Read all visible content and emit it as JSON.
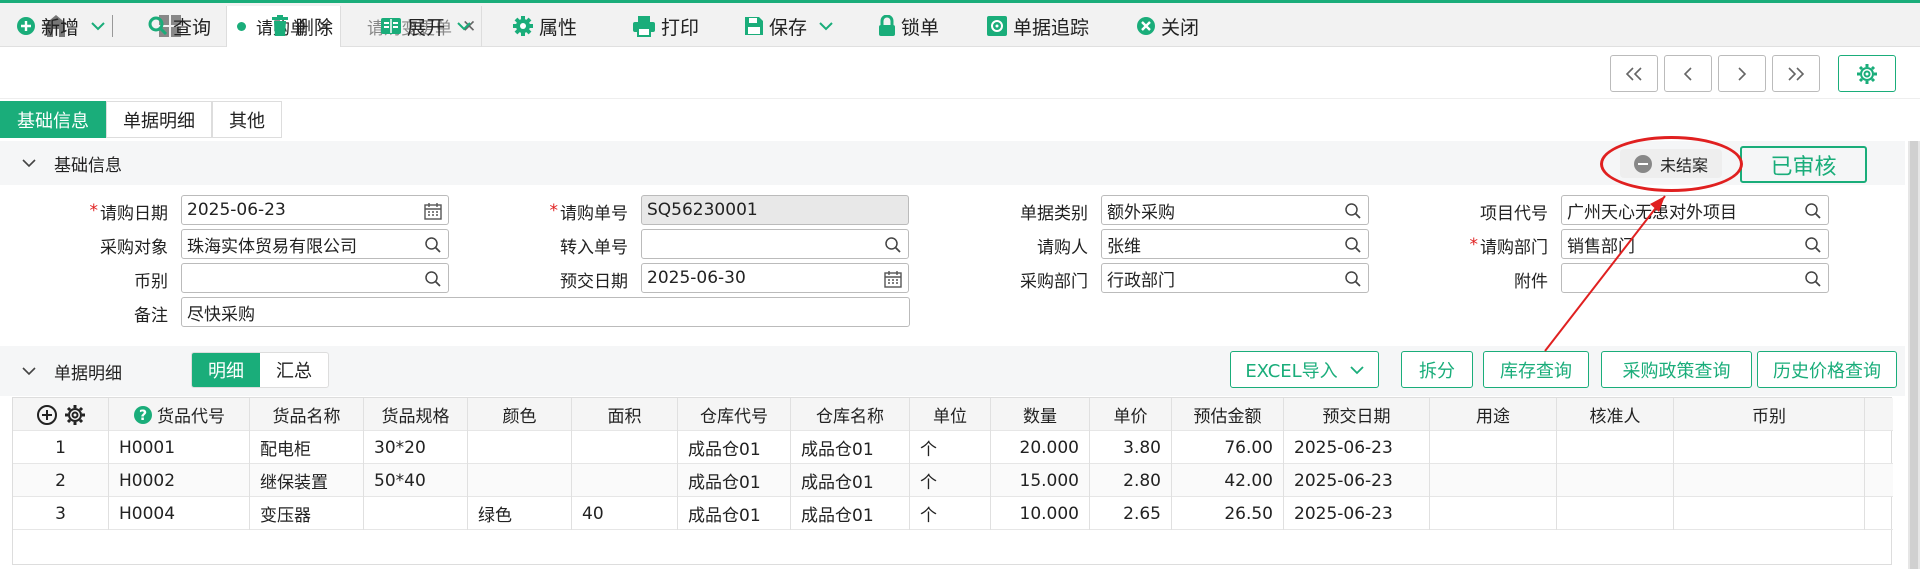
{
  "tabs": [
    {
      "label": "请购单",
      "active": true
    },
    {
      "label": "请购变更单",
      "active": false
    }
  ],
  "toolbar": {
    "new": "新增",
    "query": "查询",
    "delete": "删除",
    "expand": "展开",
    "properties": "属性",
    "print": "打印",
    "save": "保存",
    "lock": "锁单",
    "trace": "单据追踪",
    "close": "关闭"
  },
  "section_tabs": [
    "基础信息",
    "单据明细",
    "其他"
  ],
  "basic_section_title": "基础信息",
  "status_pill": "未结案",
  "audit_label": "已审核",
  "form": {
    "req_date_label": "请购日期",
    "req_date": "2025-06-23",
    "req_no_label": "请购单号",
    "req_no": "SQ56230001",
    "doc_type_label": "单据类别",
    "doc_type": "额外采购",
    "project_code_label": "项目代号",
    "project_code": "广州天心无患对外项目",
    "purchase_target_label": "采购对象",
    "purchase_target": "珠海实体贸易有限公司",
    "transfer_no_label": "转入单号",
    "transfer_no": "",
    "requester_label": "请购人",
    "requester": "张维",
    "req_dept_label": "请购部门",
    "req_dept": "销售部门",
    "currency_label": "币别",
    "currency": "",
    "delivery_date_label": "预交日期",
    "delivery_date": "2025-06-30",
    "purchase_dept_label": "采购部门",
    "purchase_dept": "行政部门",
    "attachment_label": "附件",
    "attachment": "",
    "remark_label": "备注",
    "remark": "尽快采购"
  },
  "detail": {
    "title": "单据明细",
    "seg_tabs": [
      "明细",
      "汇总"
    ],
    "buttons": {
      "excel": "EXCEL导入",
      "split": "拆分",
      "stock": "库存查询",
      "policy": "采购政策查询",
      "history": "历史价格查询"
    },
    "columns": [
      "货品代号",
      "货品名称",
      "货品规格",
      "颜色",
      "面积",
      "仓库代号",
      "仓库名称",
      "单位",
      "数量",
      "单价",
      "预估金额",
      "预交日期",
      "用途",
      "核准人",
      "币别"
    ],
    "rows": [
      {
        "no": "1",
        "code": "H0001",
        "name": "配电柜",
        "spec": "30*20",
        "color": "",
        "area": "",
        "wh_code": "成品仓01",
        "wh_name": "成品仓01",
        "unit": "个",
        "qty": "20.000",
        "price": "3.80",
        "amount": "76.00",
        "date": "2025-06-23",
        "use": "",
        "approver": "",
        "currency": ""
      },
      {
        "no": "2",
        "code": "H0002",
        "name": "继保装置",
        "spec": "50*40",
        "color": "",
        "area": "",
        "wh_code": "成品仓01",
        "wh_name": "成品仓01",
        "unit": "个",
        "qty": "15.000",
        "price": "2.80",
        "amount": "42.00",
        "date": "2025-06-23",
        "use": "",
        "approver": "",
        "currency": ""
      },
      {
        "no": "3",
        "code": "H0004",
        "name": "变压器",
        "spec": "",
        "color": "绿色",
        "area": "40",
        "wh_code": "成品仓01",
        "wh_name": "成品仓01",
        "unit": "个",
        "qty": "10.000",
        "price": "2.65",
        "amount": "26.50",
        "date": "2025-06-23",
        "use": "",
        "approver": "",
        "currency": ""
      }
    ]
  },
  "colors": {
    "accent": "#1aad7a",
    "annotation": "#e02020"
  },
  "icons": [
    "home-icon",
    "grid-icon",
    "plus-circle-icon",
    "search-icon",
    "trash-icon",
    "expand-icon",
    "gear-icon",
    "printer-icon",
    "save-icon",
    "lock-icon",
    "trace-icon",
    "close-circle-icon",
    "calendar-icon",
    "help-icon"
  ]
}
